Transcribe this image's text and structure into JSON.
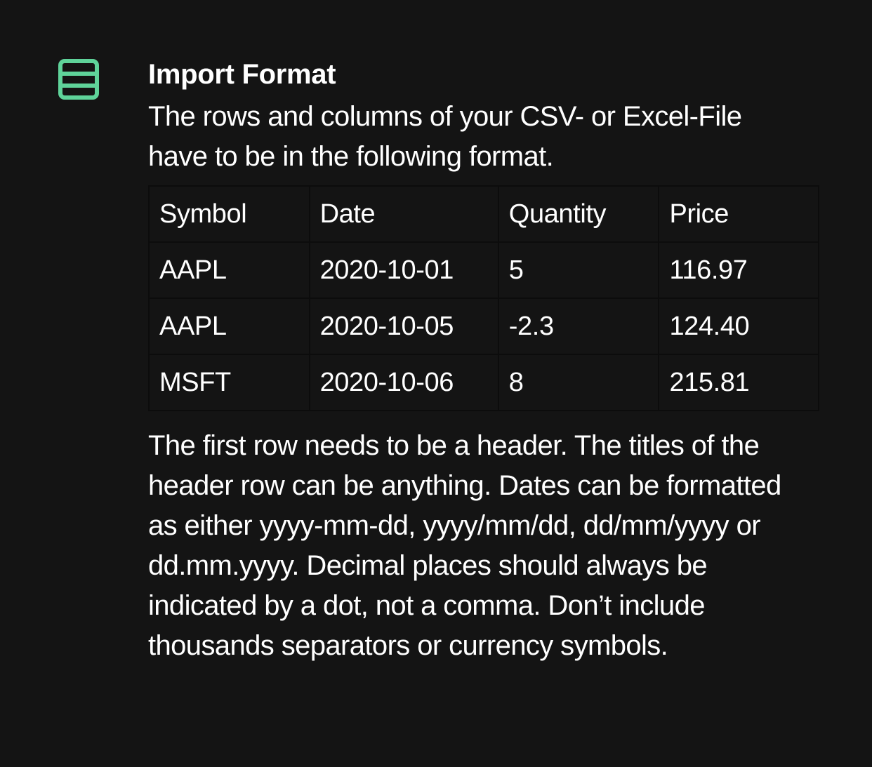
{
  "section": {
    "icon": "rows-icon",
    "accent_color": "#5fd39a",
    "title": "Import Format",
    "intro": "The rows and columns of your CSV- or Excel-File have to be in the following format.",
    "table": {
      "headers": [
        "Symbol",
        "Date",
        "Quantity",
        "Price"
      ],
      "rows": [
        [
          "AAPL",
          "2020-10-01",
          "5",
          "116.97"
        ],
        [
          "AAPL",
          "2020-10-05",
          "-2.3",
          "124.40"
        ],
        [
          "MSFT",
          "2020-10-06",
          "8",
          "215.81"
        ]
      ]
    },
    "notes": "The first row needs to be a header. The titles of the header row can be anything. Dates can be formatted as either yyyy-mm-dd, yyyy/mm/dd, dd/mm/yyyy or dd.mm.yyyy. Decimal places should always be indicated by a dot, not a comma. Don’t include thousands separators or currency symbols."
  }
}
